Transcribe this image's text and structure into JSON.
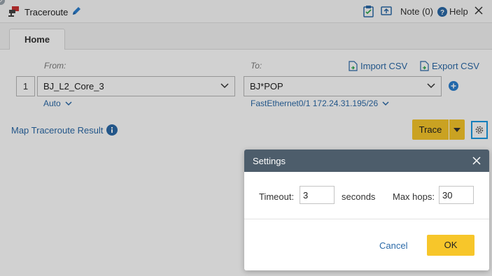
{
  "window": {
    "title": "Traceroute",
    "note_label": "Note (0)",
    "help_label": "Help"
  },
  "tabs": [
    {
      "label": "Home",
      "active": true
    }
  ],
  "form": {
    "from_label": "From:",
    "to_label": "To:",
    "import_csv": "Import CSV",
    "export_csv": "Export CSV",
    "row_number": "1",
    "from_value": "BJ_L2_Core_3",
    "to_value": "BJ*POP",
    "from_sub": "Auto",
    "to_sub": "FastEthernet0/1 172.24.31.195/26"
  },
  "main": {
    "map_result_link": "Map Traceroute Result",
    "trace_button": "Trace"
  },
  "settings_dialog": {
    "title": "Settings",
    "timeout_label": "Timeout:",
    "timeout_value": "3",
    "timeout_unit": "seconds",
    "max_hops_label": "Max hops:",
    "max_hops_value": "30",
    "cancel_label": "Cancel",
    "ok_label": "OK"
  },
  "icons": {
    "app": "network-device-icon",
    "edit": "pencil-icon",
    "clipboard": "clipboard-icon",
    "share": "share-screen-icon",
    "help": "help-circle-icon",
    "close": "close-icon",
    "csv_import": "csv-import-icon",
    "csv_export": "csv-export-icon",
    "add": "plus-circle-icon",
    "info": "info-icon",
    "settings": "gear-icon"
  },
  "colors": {
    "accent_yellow": "#f7c62a",
    "link_blue": "#2b6aa8",
    "dialog_header": "#4d5d6b",
    "focus_blue": "#1a9be6"
  }
}
